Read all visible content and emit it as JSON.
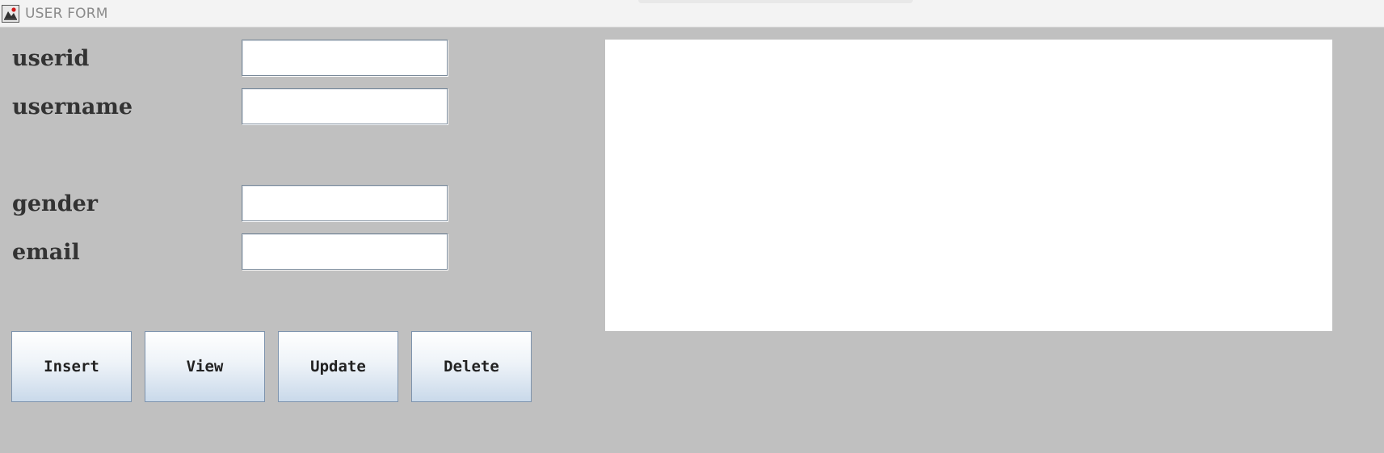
{
  "window": {
    "title": "USER FORM",
    "icon": "java-app-icon"
  },
  "form": {
    "fields": [
      {
        "label": "userid",
        "value": ""
      },
      {
        "label": "username",
        "value": ""
      },
      {
        "label": "gender",
        "value": ""
      },
      {
        "label": "email",
        "value": ""
      }
    ]
  },
  "buttons": {
    "insert": "Insert",
    "view": "View",
    "update": "Update",
    "delete": "Delete"
  },
  "output": {
    "text": ""
  },
  "colors": {
    "background": "#c0c0c0",
    "title_bar": "#f3f3f3",
    "label_text": "#333333",
    "button_gradient_top": "#ffffff",
    "button_gradient_bottom": "#c9d9ea"
  }
}
